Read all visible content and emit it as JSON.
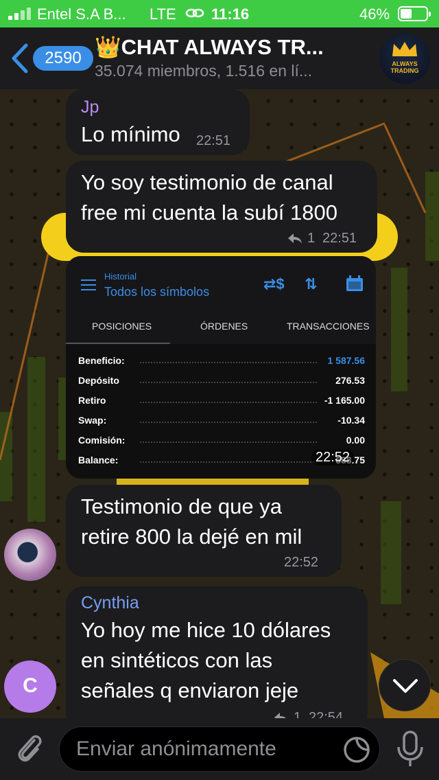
{
  "status_bar": {
    "carrier": "Entel S.A B...",
    "network": "LTE",
    "time": "11:16",
    "battery": "46%"
  },
  "header": {
    "unread_count": "2590",
    "title": "👑CHAT ALWAYS TR...",
    "subtitle": "35.074 miembros, 1.516 en lí...",
    "avatar_text": "ALWAYS TRADING"
  },
  "messages": [
    {
      "sender": "Jp",
      "sender_color": "#b98df3",
      "text": "Lo mínimo",
      "time": "22:51"
    },
    {
      "text_line1": "Yo soy testimonio de canal",
      "text_line2": "free mi cuenta la subí 1800",
      "replies": "1",
      "time": "22:51"
    },
    {
      "image": {
        "header_small": "Historial",
        "header_big": "Todos los símbolos",
        "tabs": [
          "POSICIONES",
          "ÓRDENES",
          "TRANSACCIONES"
        ],
        "rows": [
          {
            "label": "Beneficio:",
            "value": "1 587.56",
            "value_color": "#3a8ee6"
          },
          {
            "label": "Depósito",
            "value": "276.53",
            "value_color": "#ffffff"
          },
          {
            "label": "Retiro",
            "value": "-1 165.00",
            "value_color": "#ffffff"
          },
          {
            "label": "Swap:",
            "value": "-10.34",
            "value_color": "#ffffff"
          },
          {
            "label": "Comisión:",
            "value": "0.00",
            "value_color": "#ffffff"
          },
          {
            "label": "Balance:",
            "value": "688.75",
            "value_color": "#ffffff"
          }
        ],
        "time": "22:52"
      }
    },
    {
      "text_line1": "Testimonio de que ya",
      "text_line2": "retire 800 la dejé en mil",
      "time": "22:52"
    },
    {
      "sender": "Cynthia",
      "sender_color": "#7b9cf5",
      "avatar_letter": "C",
      "text_line1": "Yo hoy me hice 10 dólares",
      "text_line2": "en sintéticos con las",
      "text_line3": "señales q enviaron jeje",
      "replies": "1",
      "time": "22:54"
    }
  ],
  "input": {
    "placeholder": "Enviar anónimamente"
  },
  "colors": {
    "status_green": "#3fcc45",
    "accent_blue": "#3a8ee6",
    "bubble_bg": "#1c1c1e",
    "avatar_purple": "#b57be8"
  },
  "icons": [
    "back-chevron-icon",
    "crown-icon",
    "reply-icon",
    "attach-icon",
    "sticker-icon",
    "mic-icon",
    "chevron-down-icon"
  ]
}
